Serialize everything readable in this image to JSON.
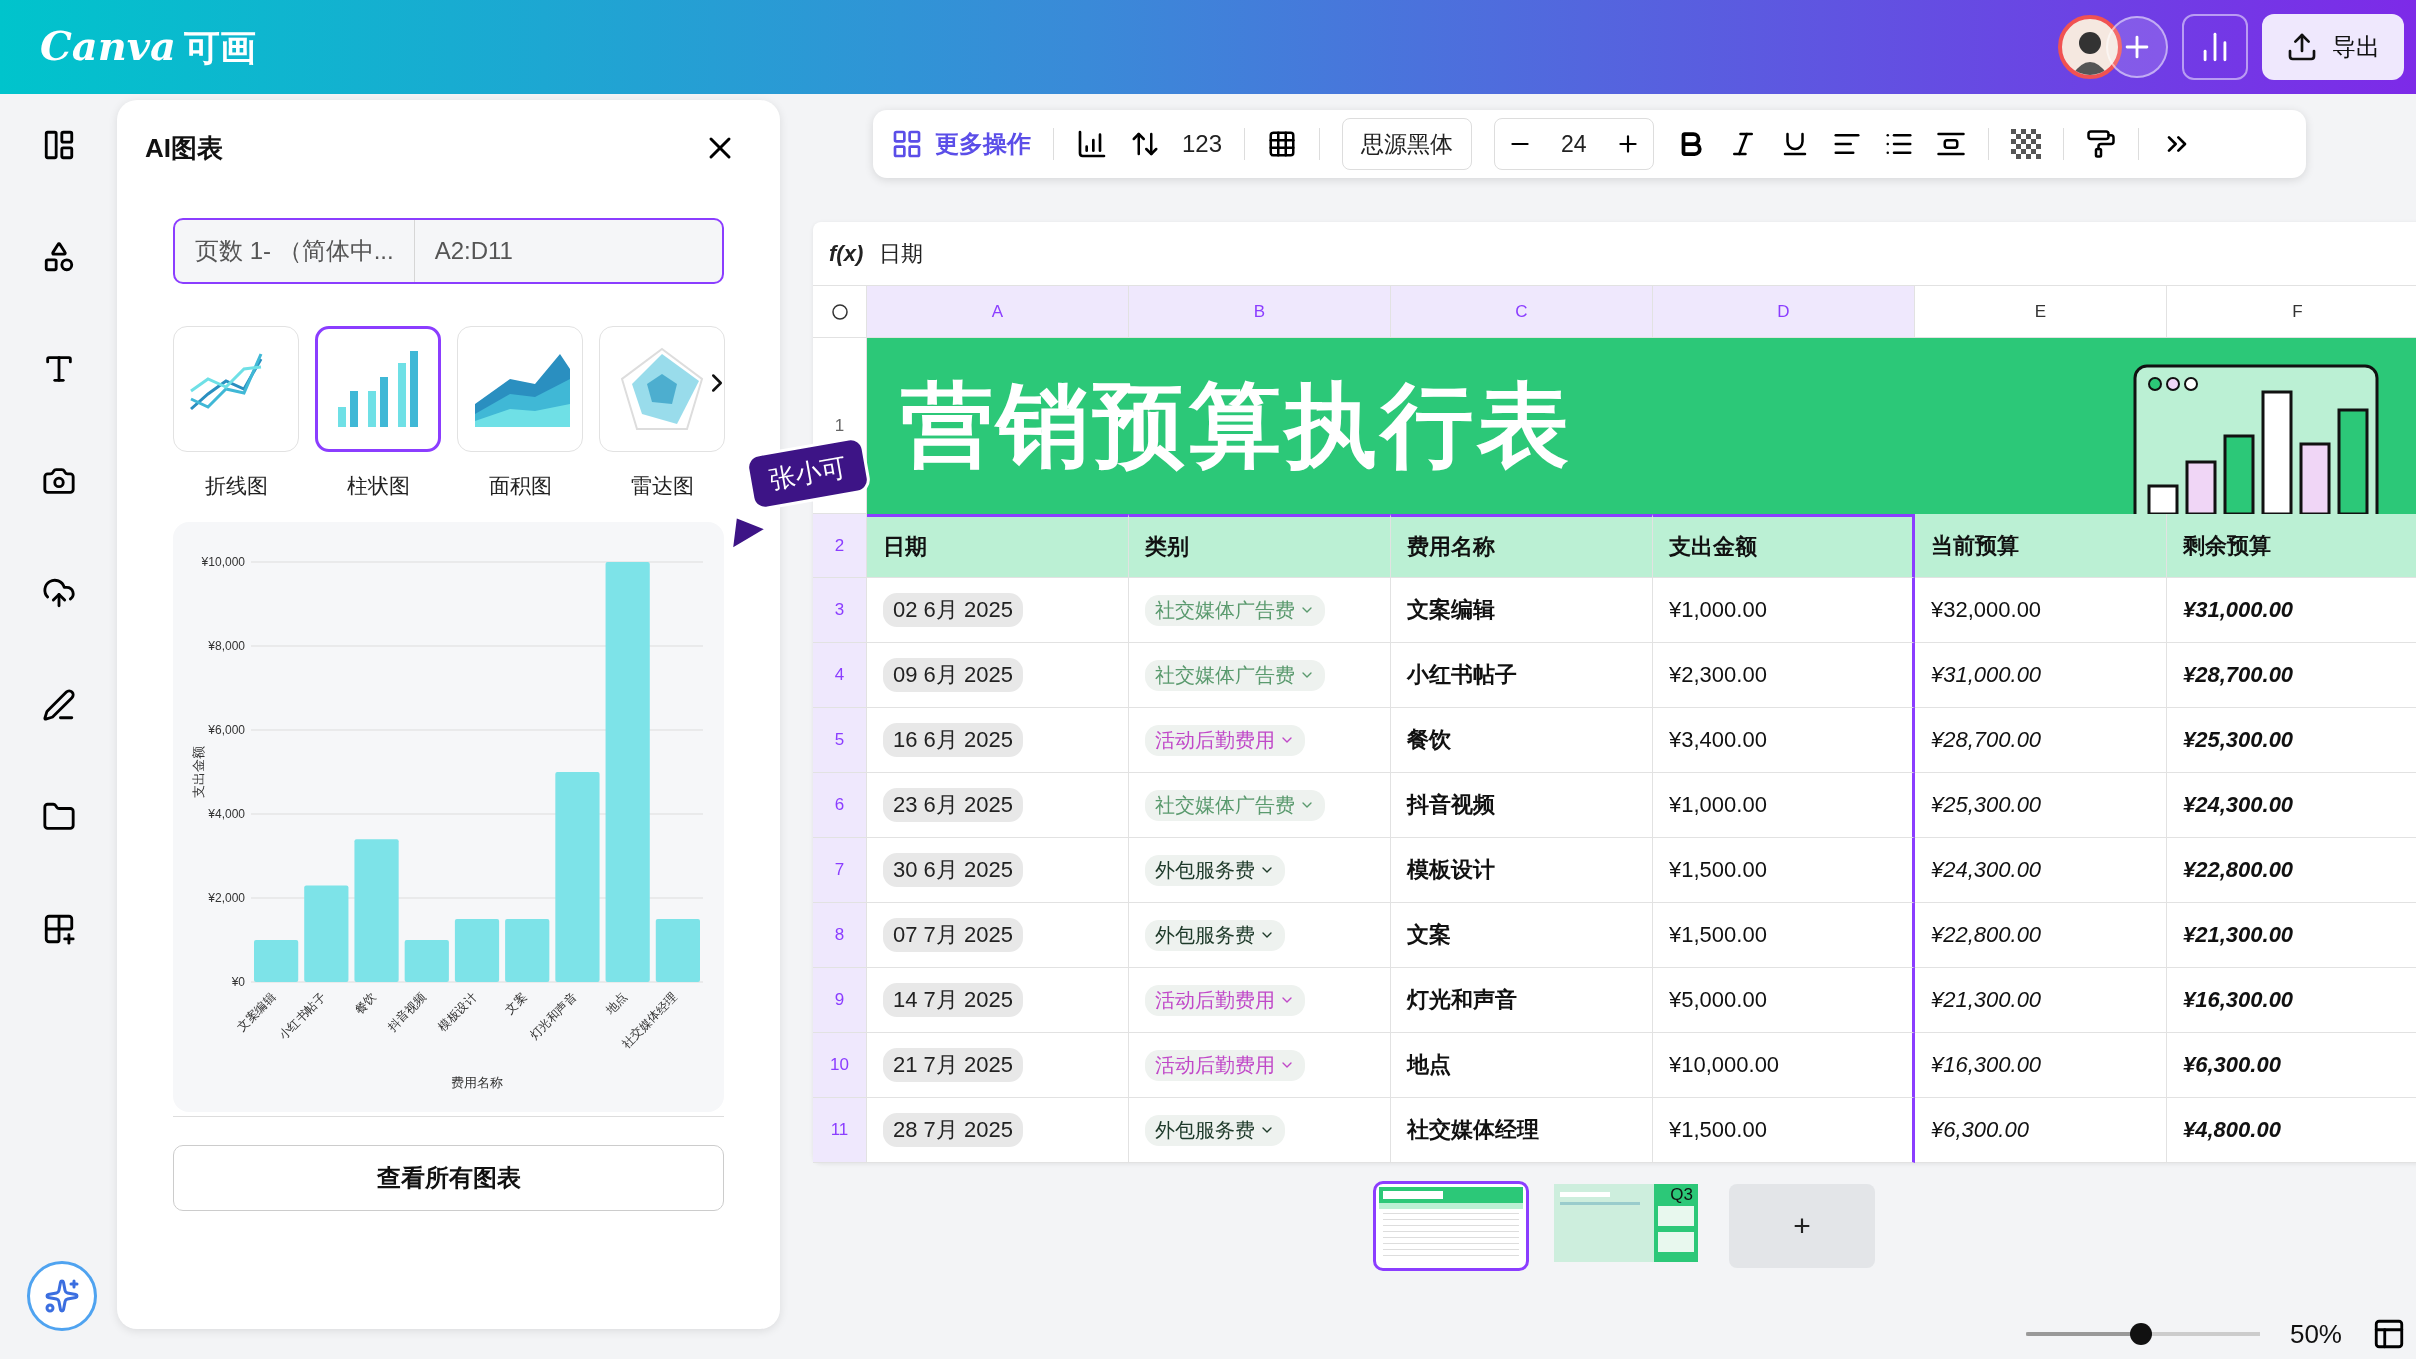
{
  "top_bar": {
    "logo": "Canva",
    "logo_cn": "可画",
    "export_label": "导出"
  },
  "panel": {
    "title": "AI图表",
    "source_sheet": "页数 1- （简体中...",
    "source_range": "A2:D11",
    "chart_types": [
      {
        "label": "折线图",
        "kind": "line",
        "selected": false
      },
      {
        "label": "柱状图",
        "kind": "bar",
        "selected": true
      },
      {
        "label": "面积图",
        "kind": "area",
        "selected": false
      },
      {
        "label": "雷达图",
        "kind": "radar",
        "selected": false
      }
    ],
    "chart_preview": {
      "chart_data": {
        "type": "bar",
        "xlabel": "费用名称",
        "ylabel": "支出金额",
        "categories": [
          "文案编辑",
          "小红书帖子",
          "餐饮",
          "抖音视频",
          "模板设计",
          "文案",
          "灯光和声音",
          "地点",
          "社交媒体经理"
        ],
        "grid": true,
        "series": [
          {
            "color": "#7de3e8",
            "values": [
              1000,
              2300,
              3400,
              1000,
              1500,
              1500,
              5000,
              10000,
              1500
            ]
          }
        ],
        "ylim": [
          0,
          10000
        ],
        "yticks": [
          {
            "value": 0,
            "label": "¥0"
          },
          {
            "value": 2000,
            "label": "¥2,000"
          },
          {
            "value": 4000,
            "label": "¥4,000"
          },
          {
            "value": 6000,
            "label": "¥6,000"
          },
          {
            "value": 8000,
            "label": "¥8,000"
          },
          {
            "value": 10000,
            "label": "¥10,000"
          }
        ]
      }
    },
    "view_all_button": "查看所有图表"
  },
  "cursor_tag": {
    "name": "张小可"
  },
  "toolbar": {
    "more_actions": "更多操作",
    "number_format": "123",
    "font": "思源黑体",
    "font_size": "24"
  },
  "sheet": {
    "formula_label": "f(x)",
    "formula_value": "日期",
    "columns": [
      {
        "label": "A",
        "selected": true
      },
      {
        "label": "B",
        "selected": true
      },
      {
        "label": "C",
        "selected": true
      },
      {
        "label": "D",
        "selected": true
      },
      {
        "label": "E",
        "selected": false
      },
      {
        "label": "F",
        "selected": false
      }
    ],
    "banner_row": {
      "number": "1",
      "title": "营销预算执行表"
    },
    "header_row": {
      "number": "2",
      "selected": true,
      "cells": [
        "日期",
        "类别",
        "费用名称",
        "支出金额",
        "当前预算",
        "剩余预算"
      ]
    },
    "rows": [
      {
        "number": "3",
        "selected": true,
        "date": "02 6月 2025",
        "category": {
          "text": "社交媒体广告费",
          "color": "#5a9a6e"
        },
        "item": "文案编辑",
        "amount": "¥1,000.00",
        "budget": {
          "text": "¥32,000.00",
          "italic": false
        },
        "remaining": "¥31,000.00"
      },
      {
        "number": "4",
        "selected": true,
        "date": "09 6月 2025",
        "category": {
          "text": "社交媒体广告费",
          "color": "#5a9a6e"
        },
        "item": "小红书帖子",
        "amount": "¥2,300.00",
        "budget": {
          "text": "¥31,000.00",
          "italic": true
        },
        "remaining": "¥28,700.00"
      },
      {
        "number": "5",
        "selected": true,
        "date": "16 6月 2025",
        "category": {
          "text": "活动后勤费用",
          "color": "#c048c8"
        },
        "item": "餐饮",
        "amount": "¥3,400.00",
        "budget": {
          "text": "¥28,700.00",
          "italic": true
        },
        "remaining": "¥25,300.00"
      },
      {
        "number": "6",
        "selected": true,
        "date": "23 6月 2025",
        "category": {
          "text": "社交媒体广告费",
          "color": "#5a9a6e"
        },
        "item": "抖音视频",
        "amount": "¥1,000.00",
        "budget": {
          "text": "¥25,300.00",
          "italic": true
        },
        "remaining": "¥24,300.00"
      },
      {
        "number": "7",
        "selected": true,
        "date": "30 6月 2025",
        "category": {
          "text": "外包服务费",
          "color": "#1e3a2a"
        },
        "item": "模板设计",
        "amount": "¥1,500.00",
        "budget": {
          "text": "¥24,300.00",
          "italic": true
        },
        "remaining": "¥22,800.00"
      },
      {
        "number": "8",
        "selected": true,
        "date": "07 7月 2025",
        "category": {
          "text": "外包服务费",
          "color": "#1e3a2a"
        },
        "item": "文案",
        "amount": "¥1,500.00",
        "budget": {
          "text": "¥22,800.00",
          "italic": true
        },
        "remaining": "¥21,300.00"
      },
      {
        "number": "9",
        "selected": true,
        "date": "14 7月 2025",
        "category": {
          "text": "活动后勤费用",
          "color": "#c048c8"
        },
        "item": "灯光和声音",
        "amount": "¥5,000.00",
        "budget": {
          "text": "¥21,300.00",
          "italic": true
        },
        "remaining": "¥16,300.00"
      },
      {
        "number": "10",
        "selected": true,
        "date": "21 7月 2025",
        "category": {
          "text": "活动后勤费用",
          "color": "#c048c8"
        },
        "item": "地点",
        "amount": "¥10,000.00",
        "budget": {
          "text": "¥16,300.00",
          "italic": true
        },
        "remaining": "¥6,300.00"
      },
      {
        "number": "11",
        "selected": true,
        "date": "28 7月 2025",
        "category": {
          "text": "外包服务费",
          "color": "#1e3a2a"
        },
        "item": "社交媒体经理",
        "amount": "¥1,500.00",
        "budget": {
          "text": "¥6,300.00",
          "italic": true
        },
        "remaining": "¥4,800.00"
      }
    ]
  },
  "pages": [
    {
      "kind": "table",
      "selected": true
    },
    {
      "kind": "notes",
      "selected": false,
      "label": "Q3"
    }
  ],
  "add_page": "+",
  "zoom": {
    "level": 0.49,
    "reading": "50%"
  }
}
